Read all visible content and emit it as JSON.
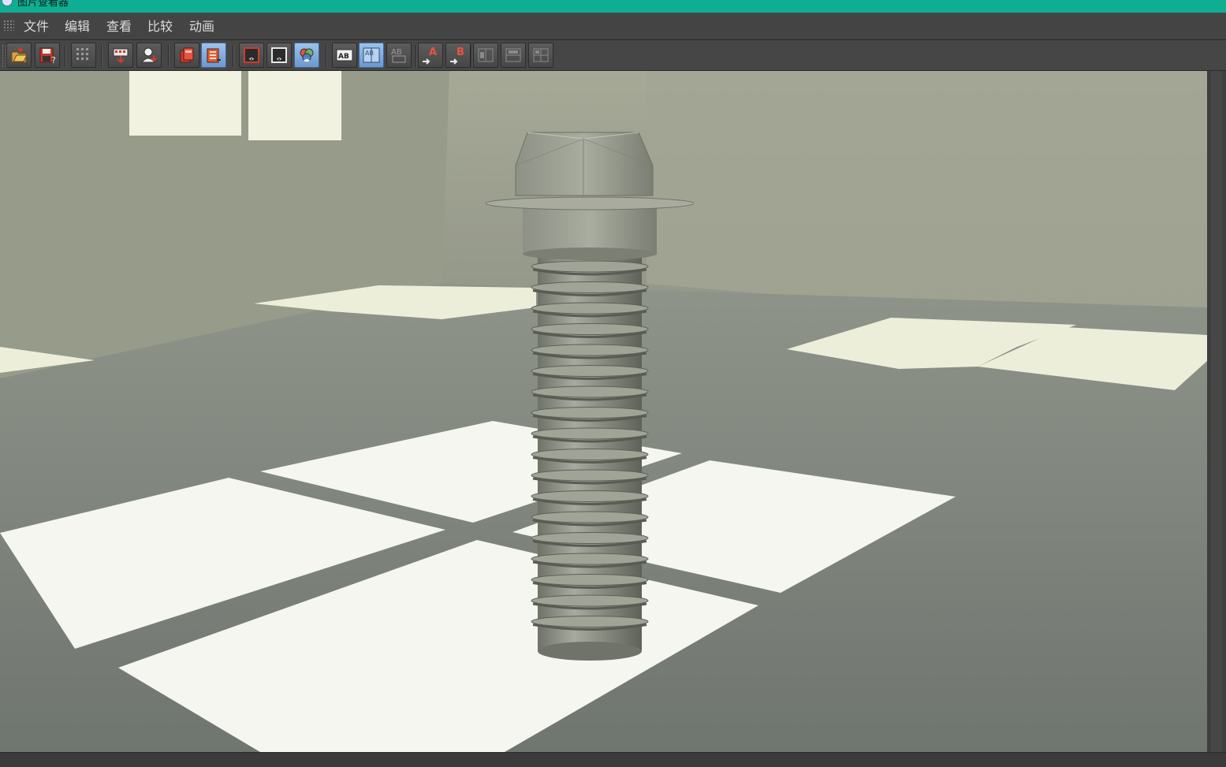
{
  "window": {
    "title": "图片查看器",
    "titlebar_color": "#0fae93"
  },
  "menu": {
    "items": [
      "文件",
      "编辑",
      "查看",
      "比较",
      "动画"
    ]
  },
  "toolbar": {
    "buttons": [
      {
        "icon": "open-folder-icon",
        "active": false
      },
      {
        "icon": "save-icon",
        "active": false
      },
      {
        "icon": "grid-icon",
        "active": false
      },
      {
        "icon": "export-sequence-icon",
        "active": false
      },
      {
        "icon": "render-user-icon",
        "active": false
      },
      {
        "icon": "copy-channel-icon",
        "active": false
      },
      {
        "icon": "history-stack-icon",
        "active": true
      },
      {
        "icon": "display-a-icon",
        "active": false
      },
      {
        "icon": "display-b-icon",
        "active": false
      },
      {
        "icon": "color-channels-icon",
        "active": false
      },
      {
        "icon": "compare-ab-icon",
        "active": false
      },
      {
        "icon": "compare-ab-split-icon",
        "active": true
      },
      {
        "icon": "compare-ab-overlay-icon",
        "active": false
      },
      {
        "icon": "set-a-icon",
        "active": false
      },
      {
        "icon": "set-b-icon",
        "active": false
      },
      {
        "icon": "wipe-horizontal-icon",
        "active": false
      },
      {
        "icon": "wipe-vertical-icon",
        "active": false
      },
      {
        "icon": "wipe-quad-icon",
        "active": false
      }
    ],
    "letter_a": "A",
    "letter_b": "B",
    "ab_text": "AB"
  },
  "viewport": {
    "image": "rendered-bolt-scene",
    "floor_color": "#858a84",
    "wall_color": "#9a9e8e",
    "highlight_color": "#f3f6ee",
    "bolt_color": "#8e9388"
  }
}
